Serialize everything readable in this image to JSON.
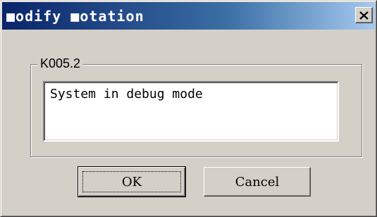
{
  "window": {
    "title": "■odify ■otation",
    "close_icon": "close-icon"
  },
  "group": {
    "label": "K005.2"
  },
  "notation_field": {
    "value": "System in debug mode"
  },
  "buttons": {
    "ok_label": "OK",
    "cancel_label": "Cancel"
  },
  "colors": {
    "face": "#d4d0c8",
    "title_start": "#0a246a",
    "title_end": "#a6caf0"
  }
}
